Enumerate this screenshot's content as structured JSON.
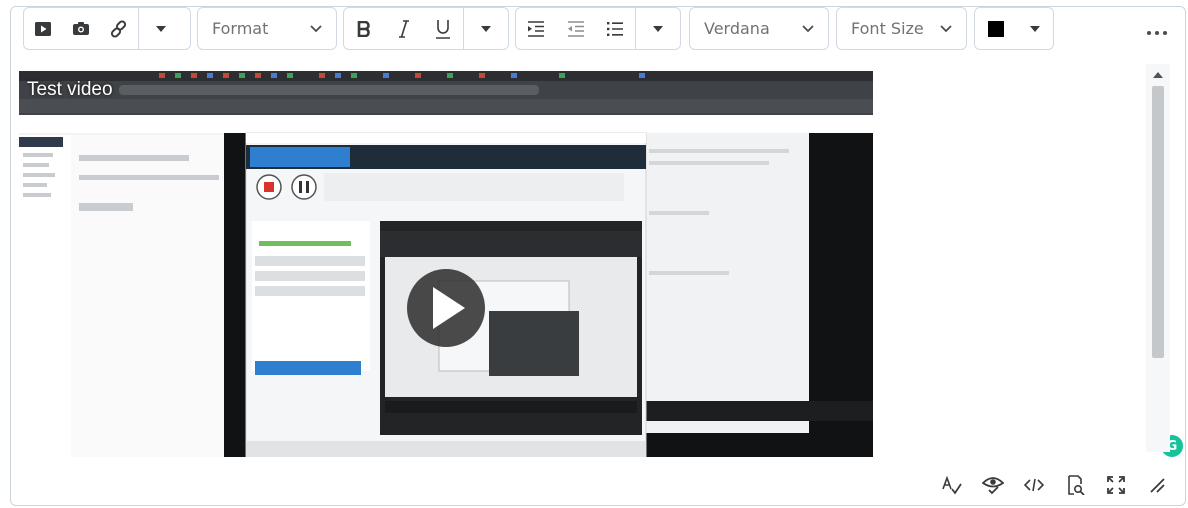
{
  "toolbar": {
    "format_label": "Format",
    "font_label": "Verdana",
    "size_label": "Font Size",
    "icons": {
      "insert_media": "video-icon",
      "insert_image": "camera-icon",
      "insert_link": "link-icon",
      "bold": "bold-icon",
      "italic": "italic-icon",
      "underline": "underline-icon",
      "indent": "indent-icon",
      "outdent": "outdent-icon",
      "list": "bullet-list-icon",
      "more": "more-icon"
    },
    "text_color": "#000000"
  },
  "video": {
    "title": "Test video"
  },
  "bottom_bar": {
    "icons": [
      "spellcheck-icon",
      "accessibility-icon",
      "source-code-icon",
      "preview-icon",
      "fullscreen-icon",
      "resize-icon"
    ]
  },
  "colors": {
    "border": "#d3d9e3",
    "icon": "#494c4e",
    "grammarly": "#15c39a"
  }
}
